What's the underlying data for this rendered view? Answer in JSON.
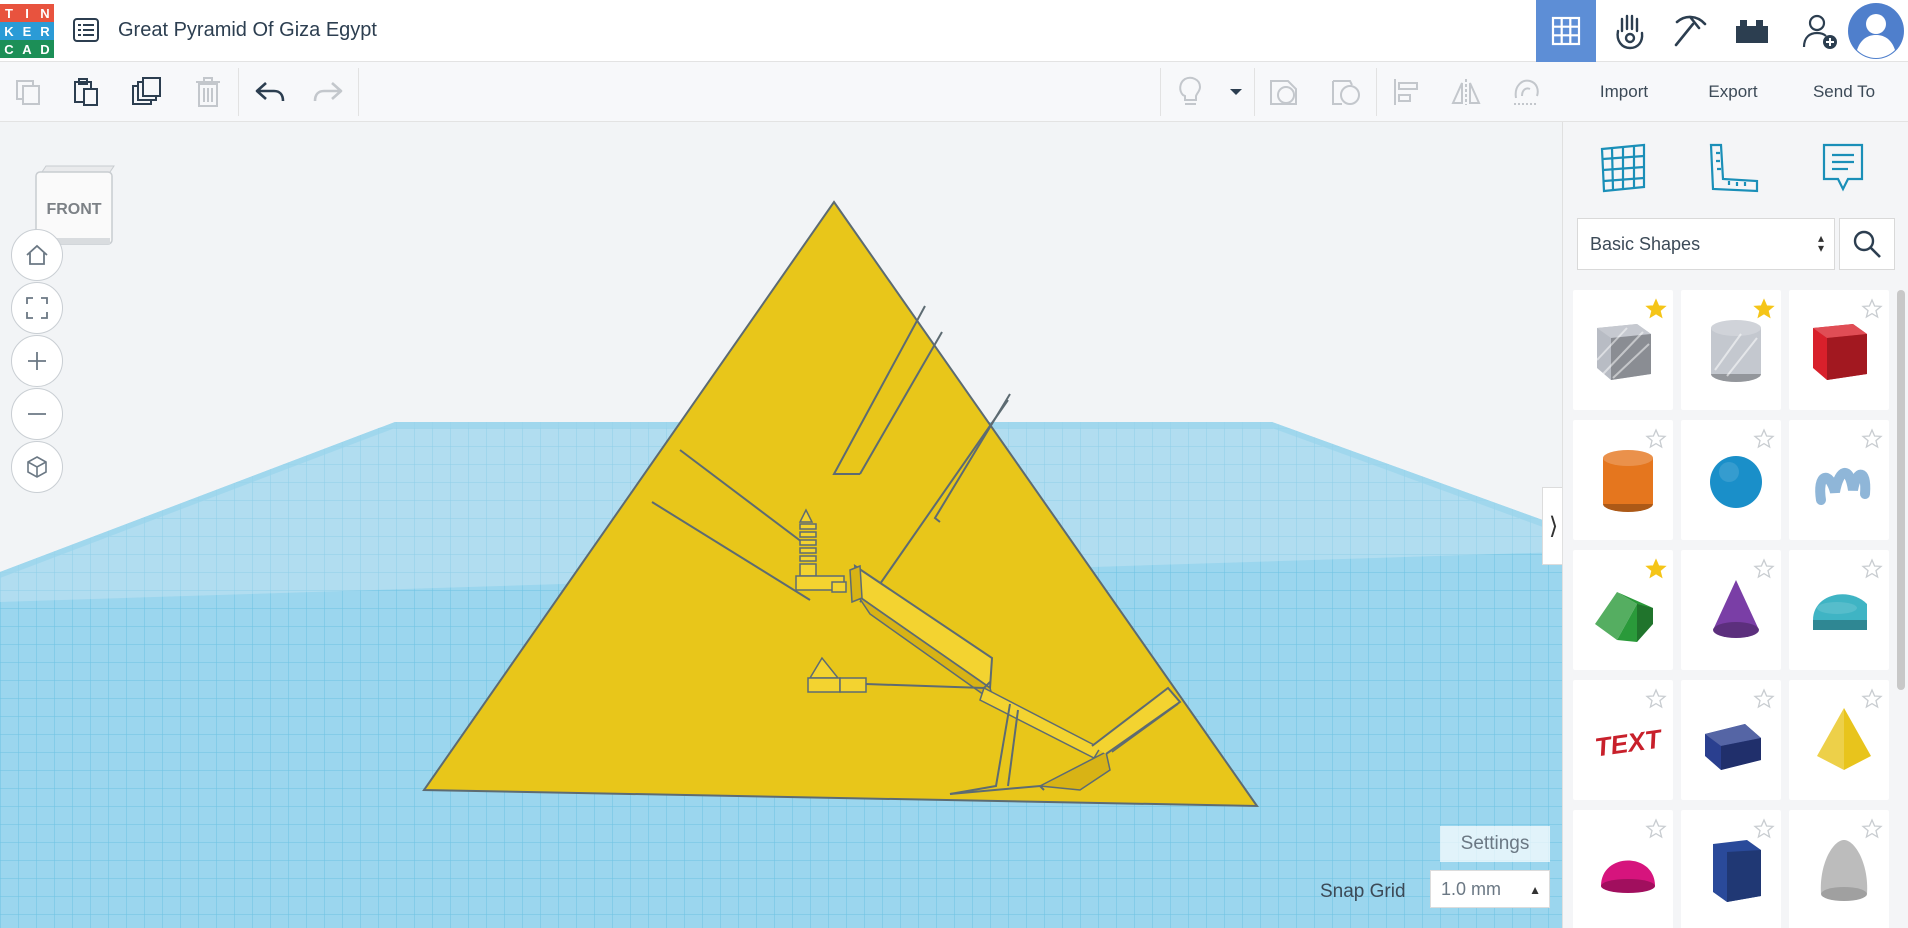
{
  "app": {
    "logo_letters": [
      "T",
      "I",
      "N",
      "K",
      "E",
      "R",
      "C",
      "A",
      "D"
    ],
    "logo_colors": [
      "#e8533e",
      "#e8533e",
      "#e8533e",
      "#2b9bd6",
      "#2b9bd6",
      "#2b9bd6",
      "#1c8f57",
      "#1c8f57",
      "#1c8f57"
    ],
    "title": "Great Pyramid Of Giza Egypt"
  },
  "topbar_icons": [
    "grid-view-icon",
    "glove-icon",
    "pickaxe-icon",
    "brick-icon",
    "add-user-icon",
    "avatar-icon"
  ],
  "toolbar": {
    "left": [
      "copy-icon",
      "paste-icon",
      "duplicate-icon",
      "delete-icon",
      "undo-icon",
      "redo-icon"
    ],
    "right": [
      "light-bulb-icon",
      "dropdown-icon",
      "group-icon",
      "ungroup-icon",
      "align-icon",
      "mirror-icon",
      "cruise-icon"
    ],
    "import_label": "Import",
    "export_label": "Export",
    "send_to_label": "Send To"
  },
  "viewport": {
    "viewcube_label": "FRONT",
    "nav_buttons": [
      "home-icon",
      "fit-all-icon",
      "zoom-in-icon",
      "zoom-out-icon",
      "perspective-icon"
    ],
    "settings_label": "Settings",
    "snap_grid_label": "Snap Grid",
    "snap_grid_value": "1.0 mm"
  },
  "panel": {
    "icons": [
      "workplane-icon",
      "ruler-icon",
      "notes-icon"
    ],
    "category": "Basic Shapes",
    "shapes": [
      {
        "name": "box",
        "color": "#b8bcc4",
        "starred": true
      },
      {
        "name": "cylinder-hole",
        "color": "#c4c8cf",
        "starred": true
      },
      {
        "name": "box-red",
        "color": "#d8202b",
        "starred": false
      },
      {
        "name": "cylinder",
        "color": "#e5761e",
        "starred": false
      },
      {
        "name": "sphere",
        "color": "#1a8fc9",
        "starred": false
      },
      {
        "name": "scribble",
        "color": "#8fb6d8",
        "starred": false
      },
      {
        "name": "roof",
        "color": "#2a9a3a",
        "starred": true
      },
      {
        "name": "cone",
        "color": "#7a3ea6",
        "starred": false
      },
      {
        "name": "round-roof",
        "color": "#3fb4c4",
        "starred": false
      },
      {
        "name": "text",
        "color": "#c8202b",
        "starred": false
      },
      {
        "name": "wedge",
        "color": "#2a3f8f",
        "starred": false
      },
      {
        "name": "pyramid",
        "color": "#e8c41c",
        "starred": false
      },
      {
        "name": "half-sphere",
        "color": "#d6147d",
        "starred": false
      },
      {
        "name": "polygon",
        "color": "#2a4a9a",
        "starred": false
      },
      {
        "name": "paraboloid",
        "color": "#bcbcbc",
        "starred": false
      }
    ]
  },
  "colors": {
    "accent": "#5d8ed6",
    "pyramid": "#e8c61a",
    "grid": "#6cc3e3"
  }
}
